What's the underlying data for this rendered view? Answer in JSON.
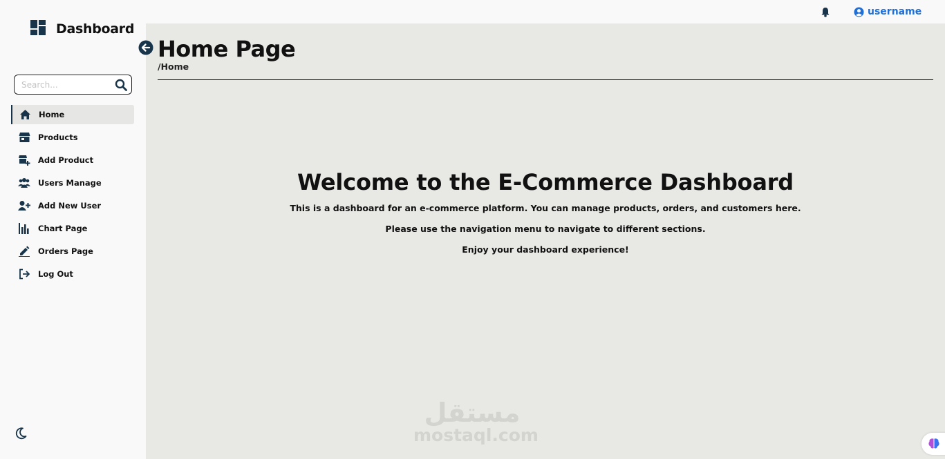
{
  "brand": {
    "title": "Dashboard",
    "icon": "dashboard-grid-icon"
  },
  "search": {
    "placeholder": "Search...",
    "icon": "magnifier-icon"
  },
  "nav": {
    "items": [
      {
        "label": "Home",
        "icon": "home-icon",
        "active": true
      },
      {
        "label": "Products",
        "icon": "store-icon"
      },
      {
        "label": "Add Product",
        "icon": "add-store-icon"
      },
      {
        "label": "Users Manage",
        "icon": "users-group-icon"
      },
      {
        "label": "Add New User",
        "icon": "user-plus-icon"
      },
      {
        "label": "Chart Page",
        "icon": "bar-chart-icon"
      },
      {
        "label": "Orders Page",
        "icon": "pen-icon"
      },
      {
        "label": "Log Out",
        "icon": "logout-icon"
      }
    ]
  },
  "topbar": {
    "username": "username",
    "bell_icon": "bell-icon",
    "user_icon": "user-circle-icon"
  },
  "header": {
    "title": "Home Page",
    "breadcrumb": "/Home"
  },
  "content": {
    "heading": "Welcome to the E-Commerce Dashboard",
    "paragraphs": [
      "This is a dashboard for an e-commerce platform. You can manage products, orders, and customers here.",
      "Please use the navigation menu to navigate to different sections.",
      "Enjoy your dashboard experience!"
    ]
  },
  "watermark": {
    "arabic": "مستقل",
    "latin": "mostaql.com"
  },
  "colors": {
    "accent": "#17344a",
    "link": "#1f6fd6",
    "content_bg": "#e8e8e4",
    "sidebar_bg": "#f9f9fa"
  }
}
